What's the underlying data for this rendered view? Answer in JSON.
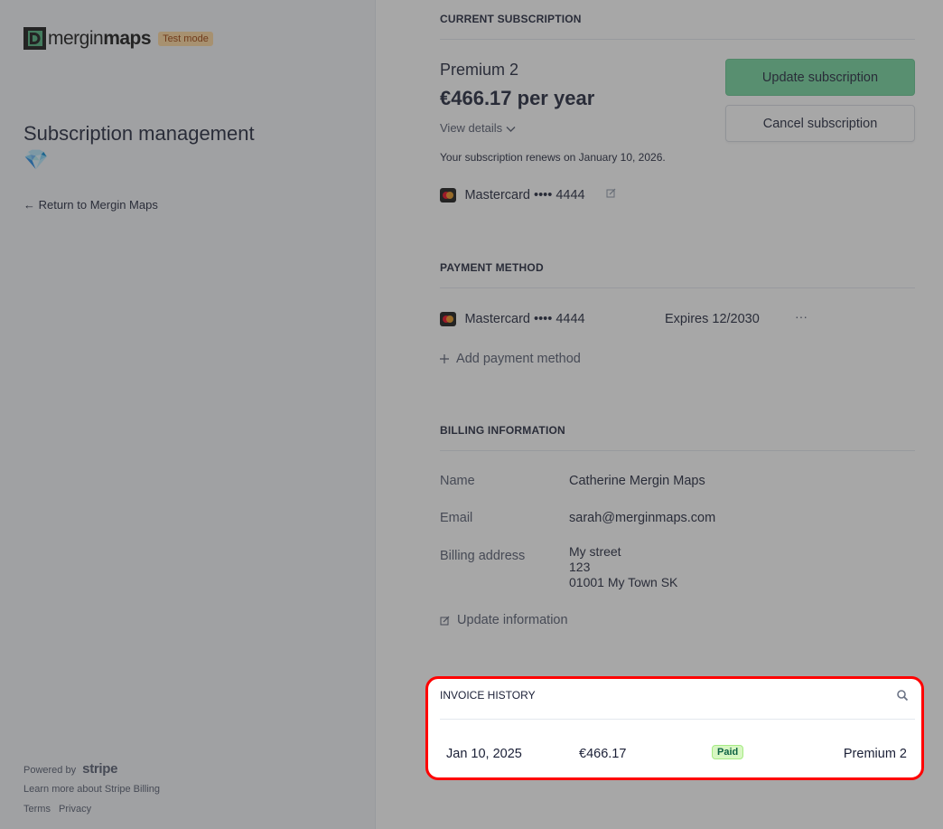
{
  "brand": {
    "name_light": "mergin",
    "name_bold": "maps",
    "test_badge": "Test mode"
  },
  "sidebar": {
    "title": "Subscription management 💎",
    "return_link": "← Return to Mergin Maps",
    "powered_by": "Powered by",
    "stripe": "stripe",
    "learn_more": "Learn more about Stripe Billing",
    "terms": "Terms",
    "privacy": "Privacy"
  },
  "current_subscription": {
    "heading": "CURRENT SUBSCRIPTION",
    "plan": "Premium 2",
    "price": "€466.17 per year",
    "view_details": "View details",
    "renews": "Your subscription renews on January 10, 2026.",
    "card": "Mastercard •••• 4444",
    "update_button": "Update subscription",
    "cancel_button": "Cancel subscription"
  },
  "payment_method": {
    "heading": "PAYMENT METHOD",
    "card": "Mastercard •••• 4444",
    "expires": "Expires 12/2030",
    "more": "···",
    "add": "Add payment method"
  },
  "billing": {
    "heading": "BILLING INFORMATION",
    "name_label": "Name",
    "name_value": "Catherine Mergin Maps",
    "email_label": "Email",
    "email_value": "sarah@merginmaps.com",
    "address_label": "Billing address",
    "address_lines": [
      "My street",
      "123",
      "01001 My Town SK"
    ],
    "update": "Update information"
  },
  "invoice_history": {
    "heading": "INVOICE HISTORY",
    "rows": [
      {
        "date": "Jan 10, 2025",
        "amount": "€466.17",
        "status": "Paid",
        "plan": "Premium 2"
      }
    ]
  },
  "colors": {
    "accent_button": "#6fd39b",
    "highlight_border": "#ff0000",
    "paid_badge": "#d7f7c2"
  }
}
